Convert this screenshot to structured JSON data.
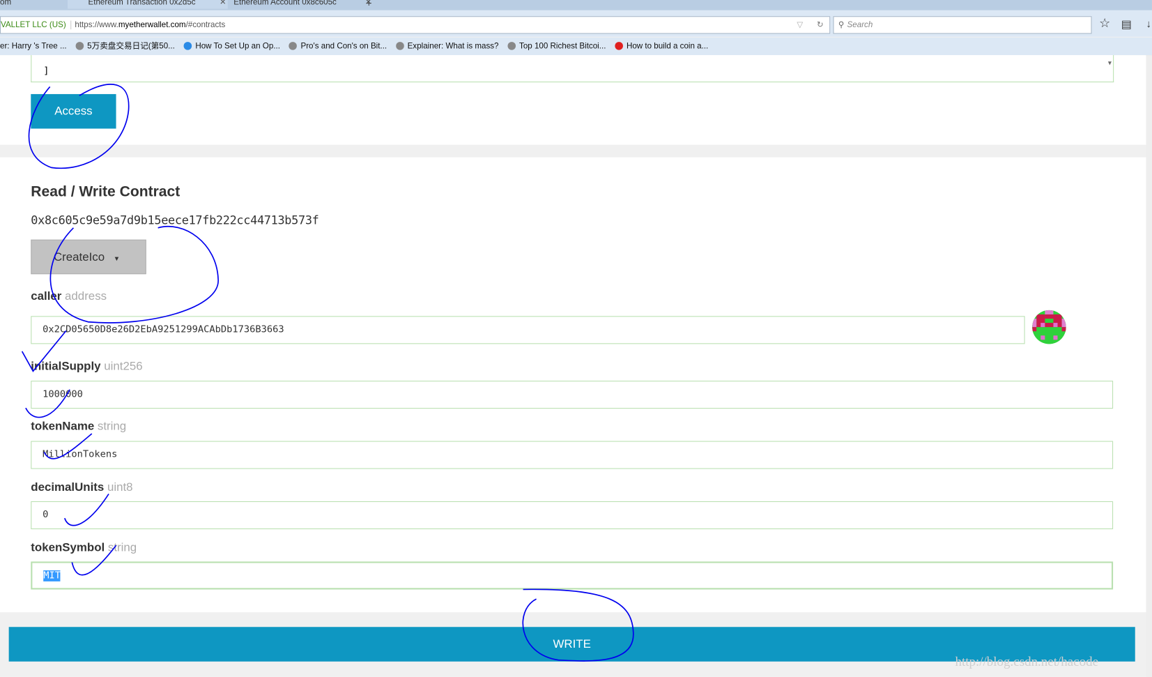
{
  "browser": {
    "tabs": [
      {
        "label": "om"
      },
      {
        "label": "Ethereum Transaction 0x2d5c"
      },
      {
        "label": "Ethereum Account 0x8c605c"
      }
    ],
    "new_tab": "+",
    "identity": "VALLET LLC (US)",
    "url_prefix": "https://www.",
    "url_host": "myetherwallet.com",
    "url_path": "/#contracts",
    "search_placeholder": "Search",
    "bookmarks": [
      "er: Harry 's Tree ...",
      "5万卖盘交易日记(第50...",
      "How To Set Up an Op...",
      "Pro's and Con's on Bit...",
      "Explainer: What is mass?",
      "Top 100 Richest Bitcoi...",
      "How to build a coin a..."
    ]
  },
  "abi_tail": "]",
  "access_label": "Access",
  "contract": {
    "title": "Read / Write Contract",
    "address": "0x8c605c9e59a7d9b15eece17fb222cc44713b573f",
    "function": "CreateIco",
    "fields": [
      {
        "name": "caller",
        "type": "address",
        "value": "0x2CD05650D8e26D2EbA9251299ACAbDb1736B3663"
      },
      {
        "name": "initialSupply",
        "type": "uint256",
        "value": "1000000"
      },
      {
        "name": "tokenName",
        "type": "string",
        "value": "MillionTokens"
      },
      {
        "name": "decimalUnits",
        "type": "uint8",
        "value": "0"
      },
      {
        "name": "tokenSymbol",
        "type": "string",
        "value": "MIT"
      }
    ]
  },
  "write_label": "WRITE",
  "watermark": "http://blog.csdn.net/hacode",
  "colors": {
    "accent": "#0e97c2",
    "input_border": "#b9e0b0",
    "annotation": "#0000ee"
  }
}
